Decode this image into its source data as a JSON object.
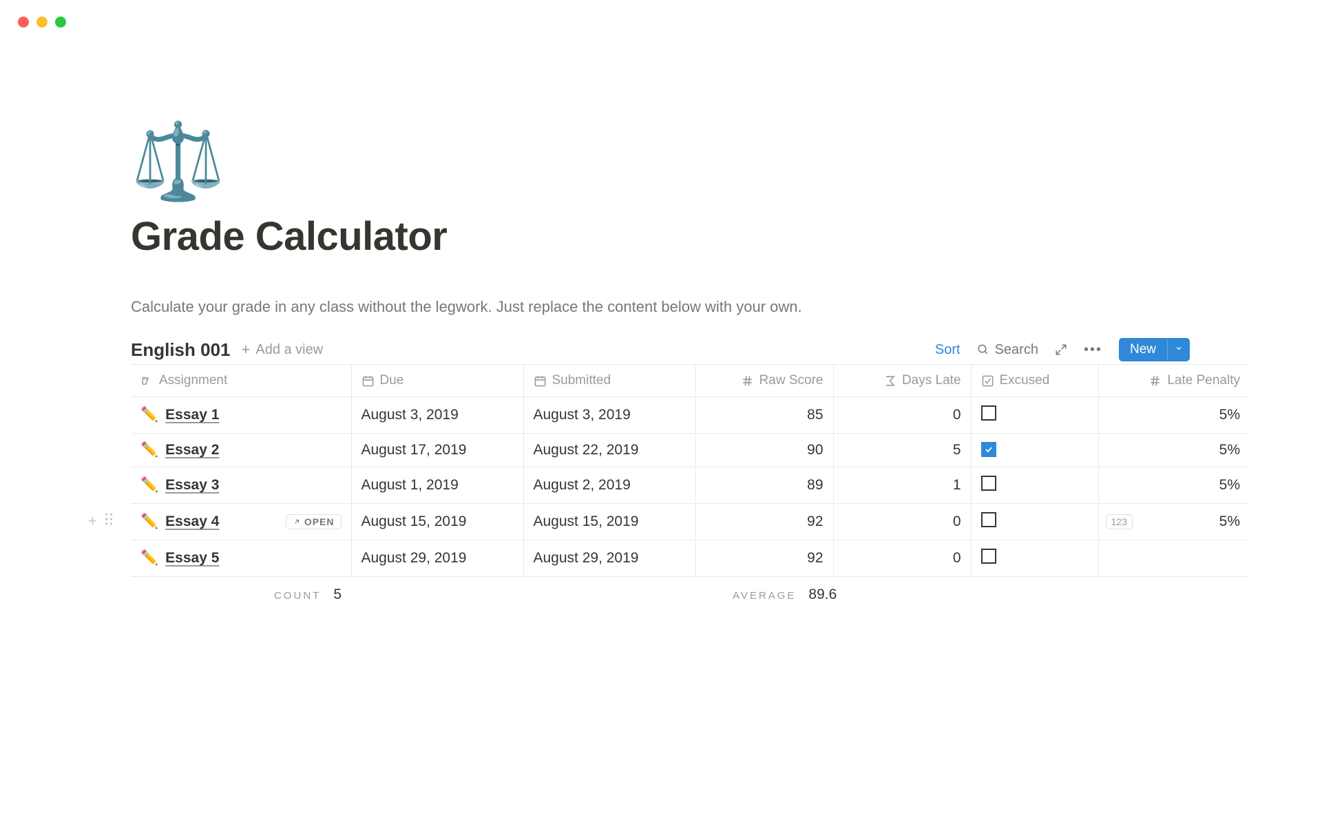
{
  "page": {
    "icon": "⚖️",
    "title": "Grade Calculator",
    "description": "Calculate your grade in any class without the legwork. Just replace the content below with your own."
  },
  "database": {
    "title": "English 001",
    "add_view_label": "Add a view",
    "toolbar": {
      "sort": "Sort",
      "search": "Search",
      "new": "New"
    },
    "columns": {
      "assignment": "Assignment",
      "due": "Due",
      "submitted": "Submitted",
      "raw_score": "Raw Score",
      "days_late": "Days Late",
      "excused": "Excused",
      "late_penalty": "Late Penalty"
    },
    "rows": [
      {
        "icon": "✏️",
        "name": "Essay 1",
        "due": "August 3, 2019",
        "submitted": "August 3, 2019",
        "raw": "85",
        "days_late": "0",
        "excused": false,
        "penalty": "5%",
        "hover": false
      },
      {
        "icon": "✏️",
        "name": "Essay 2",
        "due": "August 17, 2019",
        "submitted": "August 22, 2019",
        "raw": "90",
        "days_late": "5",
        "excused": true,
        "penalty": "5%",
        "hover": false
      },
      {
        "icon": "✏️",
        "name": "Essay 3",
        "due": "August 1, 2019",
        "submitted": "August 2, 2019",
        "raw": "89",
        "days_late": "1",
        "excused": false,
        "penalty": "5%",
        "hover": false
      },
      {
        "icon": "✏️",
        "name": "Essay 4",
        "due": "August 15, 2019",
        "submitted": "August 15, 2019",
        "raw": "92",
        "days_late": "0",
        "excused": false,
        "penalty": "5%",
        "hover": true
      },
      {
        "icon": "✏️",
        "name": "Essay 5",
        "due": "August 29, 2019",
        "submitted": "August 29, 2019",
        "raw": "92",
        "days_late": "0",
        "excused": false,
        "penalty": "",
        "hover": false
      }
    ],
    "open_label": "OPEN",
    "badge_123": "123",
    "footer": {
      "count_label": "COUNT",
      "count_value": "5",
      "average_label": "AVERAGE",
      "average_value": "89.6"
    }
  }
}
